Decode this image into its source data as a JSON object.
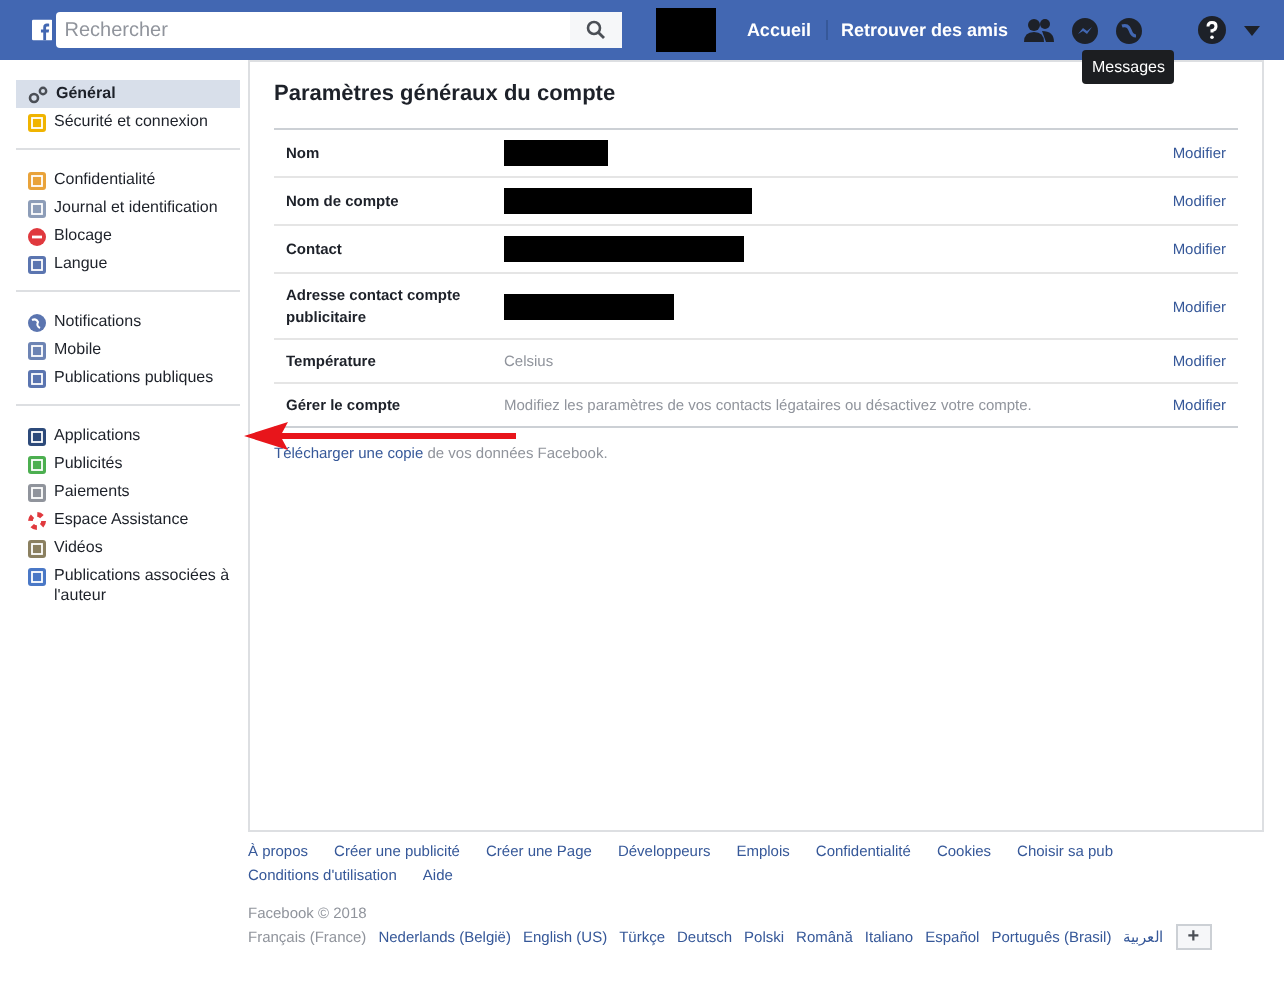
{
  "header": {
    "search": {
      "placeholder": "Rechercher"
    },
    "nav": [
      "Accueil",
      "Retrouver des amis"
    ],
    "tooltip": "Messages"
  },
  "sidebar": {
    "groups": [
      [
        {
          "label": "Général",
          "selected": true
        },
        {
          "label": "Sécurité et connexion",
          "selected": false
        }
      ],
      [
        {
          "label": "Confidentialité",
          "selected": false
        },
        {
          "label": "Journal et identification",
          "selected": false
        },
        {
          "label": "Blocage",
          "selected": false
        },
        {
          "label": "Langue",
          "selected": false
        }
      ],
      [
        {
          "label": "Notifications",
          "selected": false
        },
        {
          "label": "Mobile",
          "selected": false
        },
        {
          "label": "Publications publiques",
          "selected": false
        }
      ],
      [
        {
          "label": "Applications",
          "selected": false
        },
        {
          "label": "Publicités",
          "selected": false
        },
        {
          "label": "Paiements",
          "selected": false
        },
        {
          "label": "Espace Assistance",
          "selected": false
        },
        {
          "label": "Vidéos",
          "selected": false
        },
        {
          "label": "Publications associées à l'auteur",
          "selected": false
        }
      ]
    ]
  },
  "main": {
    "title": "Paramètres généraux du compte",
    "rows": [
      {
        "label": "Nom",
        "kind": "redacted",
        "action": "Modifier"
      },
      {
        "label": "Nom de compte",
        "kind": "redacted",
        "action": "Modifier"
      },
      {
        "label": "Contact",
        "kind": "redacted",
        "action": "Modifier"
      },
      {
        "label": "Adresse contact compte publicitaire",
        "kind": "redacted",
        "action": "Modifier"
      },
      {
        "label": "Température",
        "kind": "text",
        "value": "Celsius",
        "action": "Modifier"
      },
      {
        "label": "Gérer le compte",
        "kind": "text",
        "value": "Modifiez les paramètres de vos contacts légataires ou désactivez votre compte.",
        "action": "Modifier"
      }
    ],
    "download": {
      "link": "Télécharger une copie",
      "rest": "de vos données Facebook."
    }
  },
  "footer": {
    "links": [
      "À propos",
      "Créer une publicité",
      "Créer une Page",
      "Développeurs",
      "Emplois",
      "Confidentialité",
      "Cookies",
      "Choisir sa pub",
      "Conditions d'utilisation",
      "Aide"
    ],
    "copyright": "Facebook © 2018",
    "languages": [
      {
        "label": "Français (France)",
        "selected": true
      },
      {
        "label": "Nederlands (België)",
        "selected": false
      },
      {
        "label": "English (US)",
        "selected": false
      },
      {
        "label": "Türkçe",
        "selected": false
      },
      {
        "label": "Deutsch",
        "selected": false
      },
      {
        "label": "Polski",
        "selected": false
      },
      {
        "label": "Română",
        "selected": false
      },
      {
        "label": "Italiano",
        "selected": false
      },
      {
        "label": "Español",
        "selected": false
      },
      {
        "label": "Português (Brasil)",
        "selected": false
      },
      {
        "label": "العربية",
        "selected": false
      }
    ],
    "more": "+"
  }
}
